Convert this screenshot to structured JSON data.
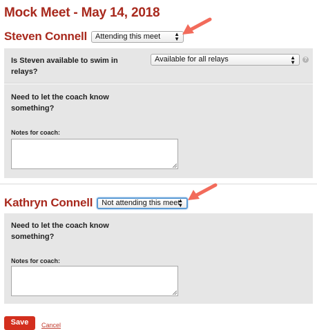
{
  "page": {
    "title": "Mock Meet - May 14, 2018"
  },
  "swimmers": [
    {
      "name": "Steven Connell",
      "attendance": "Attending this meet",
      "relay_question": "Is Steven available to swim in relays?",
      "relay_selection": "Available for all relays",
      "coach_prompt": "Need to let the coach know something?",
      "notes_label": "Notes for coach:",
      "notes_value": ""
    },
    {
      "name": "Kathryn Connell",
      "attendance": "Not attending this meet",
      "coach_prompt": "Need to let the coach know something?",
      "notes_label": "Notes for coach:",
      "notes_value": ""
    }
  ],
  "actions": {
    "save_label": "Save",
    "cancel_label": "Cancel"
  },
  "icons": {
    "select_caret": "updown-caret-icon",
    "help": "help-icon",
    "annotation": "arrow-icon"
  },
  "colors": {
    "title": "#a8291d",
    "panel_bg": "#e6e6e6",
    "save_button": "#d32f1e",
    "arrow": "#f26b5b",
    "focus_ring": "#5b9bd5"
  }
}
